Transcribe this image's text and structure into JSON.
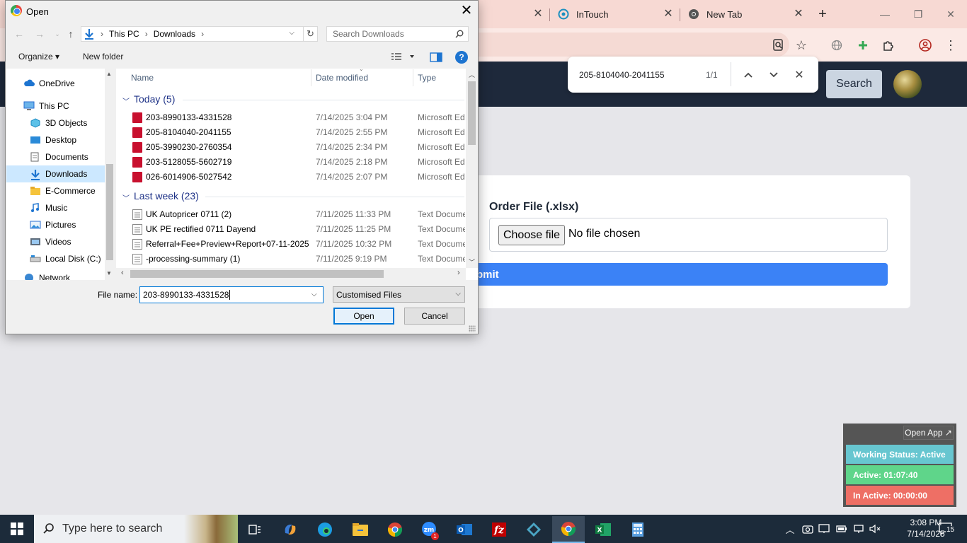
{
  "browser": {
    "tabs": [
      {
        "label": ""
      },
      {
        "label": "InTouch"
      },
      {
        "label": "New Tab"
      }
    ],
    "find": {
      "query": "205-8104040-2041155",
      "count": "1/1"
    }
  },
  "page": {
    "search_button": "Search",
    "order_file_label": "Order File (.xlsx)",
    "choose_file": "Choose file",
    "no_file": "No file chosen",
    "submit_label": "bmit"
  },
  "widget": {
    "open_app": "Open App ↗",
    "working_status": "Working Status: Active",
    "active": "Active: 01:07:40",
    "inactive": "In Active: 00:00:00",
    "colors": {
      "working": "#67c6d0",
      "active": "#5fd58a",
      "inactive": "#ee6f65"
    }
  },
  "dialog": {
    "title": "Open",
    "breadcrumb": [
      "This PC",
      "›",
      "Downloads",
      "›"
    ],
    "search_placeholder": "Search Downloads",
    "organize": "Organize ▾",
    "new_folder": "New folder",
    "nav": [
      {
        "label": "OneDrive",
        "icon": "cloud-icon"
      },
      {
        "label": "This PC",
        "icon": "pc-icon"
      },
      {
        "label": "3D Objects",
        "icon": "cube-icon"
      },
      {
        "label": "Desktop",
        "icon": "desktop-icon"
      },
      {
        "label": "Documents",
        "icon": "document-icon"
      },
      {
        "label": "Downloads",
        "icon": "download-icon"
      },
      {
        "label": "E-Commerce",
        "icon": "folder-icon"
      },
      {
        "label": "Music",
        "icon": "music-icon"
      },
      {
        "label": "Pictures",
        "icon": "pictures-icon"
      },
      {
        "label": "Videos",
        "icon": "videos-icon"
      },
      {
        "label": "Local Disk (C:)",
        "icon": "disk-icon"
      },
      {
        "label": "Network",
        "icon": "network-icon"
      }
    ],
    "columns": {
      "name": "Name",
      "date": "Date modified",
      "type": "Type"
    },
    "groups": [
      {
        "label": "Today (5)",
        "files": [
          {
            "name": "203-8990133-4331528",
            "date": "7/14/2025 3:04 PM",
            "type": "Microsoft Edge",
            "kind": "pdf"
          },
          {
            "name": "205-8104040-2041155",
            "date": "7/14/2025 2:55 PM",
            "type": "Microsoft Edge",
            "kind": "pdf"
          },
          {
            "name": "205-3990230-2760354",
            "date": "7/14/2025 2:34 PM",
            "type": "Microsoft Edge",
            "kind": "pdf"
          },
          {
            "name": "203-5128055-5602719",
            "date": "7/14/2025 2:18 PM",
            "type": "Microsoft Edge",
            "kind": "pdf"
          },
          {
            "name": "026-6014906-5027542",
            "date": "7/14/2025 2:07 PM",
            "type": "Microsoft Edge",
            "kind": "pdf"
          }
        ]
      },
      {
        "label": "Last week (23)",
        "files": [
          {
            "name": "UK Autopricer 0711 (2)",
            "date": "7/11/2025 11:33 PM",
            "type": "Text Document",
            "kind": "txt"
          },
          {
            "name": "UK PE rectified 0711 Dayend",
            "date": "7/11/2025 11:25 PM",
            "type": "Text Document",
            "kind": "txt"
          },
          {
            "name": "Referral+Fee+Preview+Report+07-11-2025",
            "date": "7/11/2025 10:32 PM",
            "type": "Text Document",
            "kind": "txt"
          },
          {
            "name": "-processing-summary (1)",
            "date": "7/11/2025 9:19 PM",
            "type": "Text Document",
            "kind": "txt"
          }
        ]
      }
    ],
    "file_name_label": "File name:",
    "file_name_value": "203-8990133-4331528",
    "file_type": "Customised Files",
    "open_button": "Open",
    "cancel_button": "Cancel"
  },
  "taskbar": {
    "search_placeholder": "Type here to search",
    "clock_time": "3:08 PM",
    "clock_date": "7/14/2025",
    "notification_count": "15",
    "zoom_badge": "1"
  }
}
